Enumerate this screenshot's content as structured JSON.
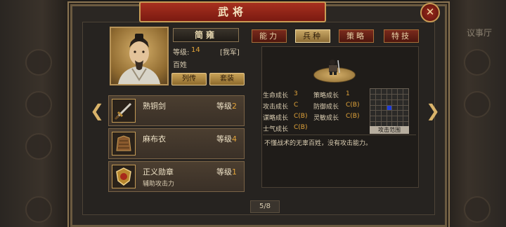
{
  "window": {
    "title": "武将",
    "close_label": "✕"
  },
  "background": {
    "right_label": "议事厅"
  },
  "general": {
    "name": "简雍",
    "level_label": "等级:",
    "level_value": "14",
    "side": "[我军]",
    "profession": "百姓"
  },
  "buttons": {
    "biography": "列传",
    "outfit": "套装"
  },
  "equipment": [
    {
      "name": "熟铜剑",
      "level_label": "等级",
      "level": "2",
      "desc": ""
    },
    {
      "name": "麻布衣",
      "level_label": "等级",
      "level": "4",
      "desc": ""
    },
    {
      "name": "正义勋章",
      "level_label": "等级",
      "level": "1",
      "desc": "辅助攻击力"
    }
  ],
  "tabs": [
    {
      "label": "能力",
      "active": false
    },
    {
      "label": "兵种",
      "active": true
    },
    {
      "label": "策略",
      "active": false
    },
    {
      "label": "特技",
      "active": false
    }
  ],
  "stats": {
    "hp_label": "生命成长",
    "hp_value": "3",
    "strategy_label": "策略成长",
    "strategy_value": "1",
    "atk_label": "攻击成长",
    "atk_value": "C",
    "def_label": "防御成长",
    "def_value": "C(B)",
    "int_label": "谋略成长",
    "int_value": "C(B)",
    "agi_label": "灵敏成长",
    "agi_value": "C(B)",
    "morale_label": "士气成长",
    "morale_value": "C(B)"
  },
  "attack_range": {
    "label": "攻击范围",
    "grid_size": 7,
    "hit_cells": [
      24
    ]
  },
  "unit_description": "不懂战术的无辜百姓，没有攻击能力。",
  "pager": "5/8",
  "colors": {
    "accent_gold": "#e2a43a",
    "title_red": "#a7301f",
    "range_blue": "#1e3cd8"
  }
}
